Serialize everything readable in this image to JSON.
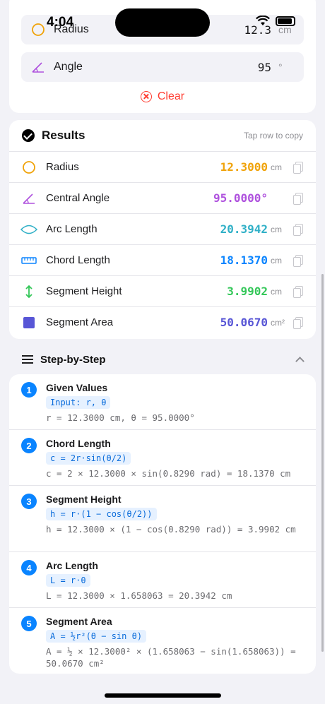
{
  "status_bar": {
    "time": "4:04"
  },
  "inputs": {
    "radius": {
      "label": "Radius",
      "value": "12.3",
      "unit": "cm"
    },
    "angle": {
      "label": "Angle",
      "value": "95",
      "unit": "°"
    },
    "clear_label": "Clear"
  },
  "results": {
    "title": "Results",
    "hint": "Tap row to copy",
    "rows": [
      {
        "label": "Radius",
        "value": "12.3000",
        "unit": "cm",
        "color": "#f0a30a",
        "icon": "circle-icon"
      },
      {
        "label": "Central Angle",
        "value": "95.0000°",
        "unit": "",
        "color": "#af52de",
        "icon": "angle-icon"
      },
      {
        "label": "Arc Length",
        "value": "20.3942",
        "unit": "cm",
        "color": "#30b0c7",
        "icon": "arc-icon"
      },
      {
        "label": "Chord Length",
        "value": "18.1370",
        "unit": "cm",
        "color": "#0a84ff",
        "icon": "ruler-icon"
      },
      {
        "label": "Segment Height",
        "value": "3.9902",
        "unit": "cm",
        "color": "#34c759",
        "icon": "vertical-arrows-icon"
      },
      {
        "label": "Segment Area",
        "value": "50.0670",
        "unit": "cm²",
        "color": "#5856d6",
        "icon": "square-icon"
      }
    ]
  },
  "steps": {
    "title": "Step-by-Step",
    "items": [
      {
        "num": "1",
        "title": "Given Values",
        "formula": "Input: r, θ",
        "calc": "r = 12.3000 cm, θ = 95.0000°"
      },
      {
        "num": "2",
        "title": "Chord Length",
        "formula": "c = 2r·sin(θ/2)",
        "calc": "c = 2 × 12.3000 × sin(0.8290 rad) = 18.1370 cm"
      },
      {
        "num": "3",
        "title": "Segment Height",
        "formula": "h = r·(1 − cos(θ/2))",
        "calc": "h = 12.3000 × (1 − cos(0.8290 rad)) = 3.9902 cm"
      },
      {
        "num": "4",
        "title": "Arc Length",
        "formula": "L = r·θ",
        "calc": "L = 12.3000 × 1.658063 = 20.3942 cm"
      },
      {
        "num": "5",
        "title": "Segment Area",
        "formula": "A = ½r²(θ − sin θ)",
        "calc": "A = ½ × 12.3000² × (1.658063 − sin(1.658063)) = 50.0670 cm²"
      }
    ]
  },
  "colors": {
    "accent": "#0a84ff",
    "clear": "#ff3b30",
    "background": "#f2f2f7"
  }
}
